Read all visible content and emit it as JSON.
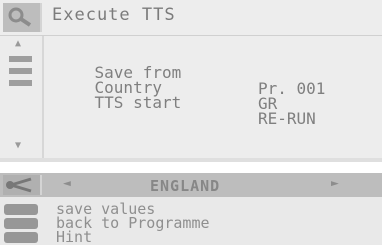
{
  "header": {
    "title": "Execute TTS"
  },
  "settings": [
    {
      "label": "Save from",
      "value": "Pr. 001"
    },
    {
      "label": "Country",
      "value": "GR"
    },
    {
      "label": "TTS start",
      "value": "RE-RUN"
    }
  ],
  "language": {
    "left_arrow": "◄",
    "current": "ENGLAND",
    "right_arrow": "►"
  },
  "menu": [
    {
      "label": "save values",
      "icon": "save-icon"
    },
    {
      "label": "back to Programme",
      "icon": "back-icon"
    },
    {
      "label": "Hint",
      "icon": "hint-icon"
    }
  ],
  "colors": {
    "panel": "#ededed",
    "icon_box": "#bdbdbd",
    "text": "#7f7f7f"
  }
}
